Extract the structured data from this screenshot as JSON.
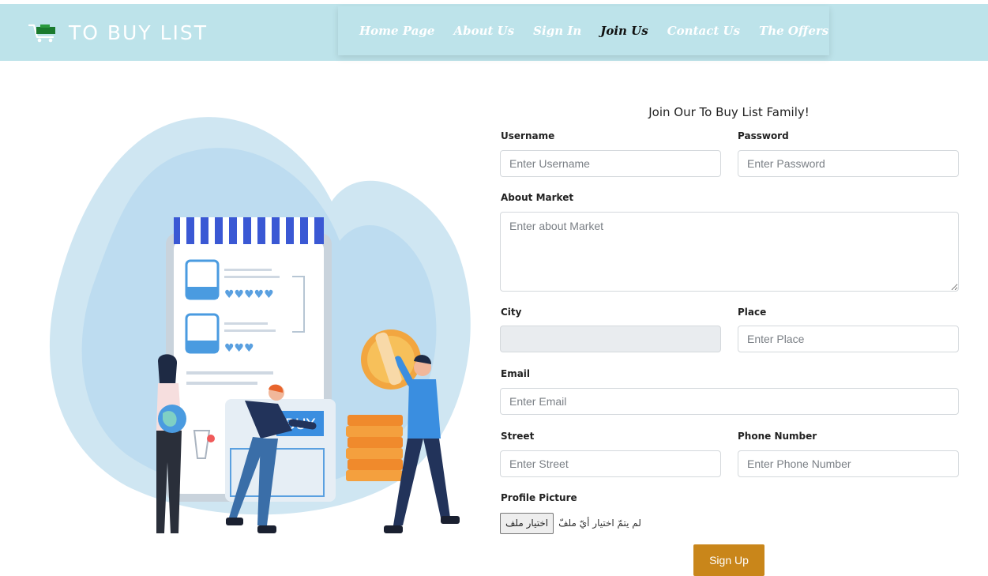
{
  "brand": {
    "title": "TO BUY LIST",
    "icon": "shopping-cart-icon"
  },
  "nav": [
    {
      "label": "Home Page",
      "active": false
    },
    {
      "label": "About Us",
      "active": false
    },
    {
      "label": "Sign In",
      "active": false
    },
    {
      "label": "Join Us",
      "active": true
    },
    {
      "label": "Contact Us",
      "active": false
    },
    {
      "label": "The Offers",
      "active": false
    }
  ],
  "illustration": {
    "sign_text": "BUY"
  },
  "form": {
    "title": "Join Our To Buy List Family!",
    "username": {
      "label": "Username",
      "placeholder": "Enter Username"
    },
    "password": {
      "label": "Password",
      "placeholder": "Enter Password"
    },
    "about": {
      "label": "About Market",
      "placeholder": "Enter about Market"
    },
    "city": {
      "label": "City",
      "value": ""
    },
    "place": {
      "label": "Place",
      "placeholder": "Enter Place"
    },
    "email": {
      "label": "Email",
      "placeholder": "Enter Email"
    },
    "street": {
      "label": "Street",
      "placeholder": "Enter Street"
    },
    "phone": {
      "label": "Phone Number",
      "placeholder": "Enter Phone Number"
    },
    "picture": {
      "label": "Profile Picture",
      "button": "اختيار ملف",
      "status": "لم يتمّ اختيار أيّ ملفّ"
    },
    "submit": "Sign Up"
  },
  "colors": {
    "header_bg": "#bde3ea",
    "accent_button": "#c9861a",
    "active_nav": "#111111",
    "nav_text": "#ffffff"
  }
}
